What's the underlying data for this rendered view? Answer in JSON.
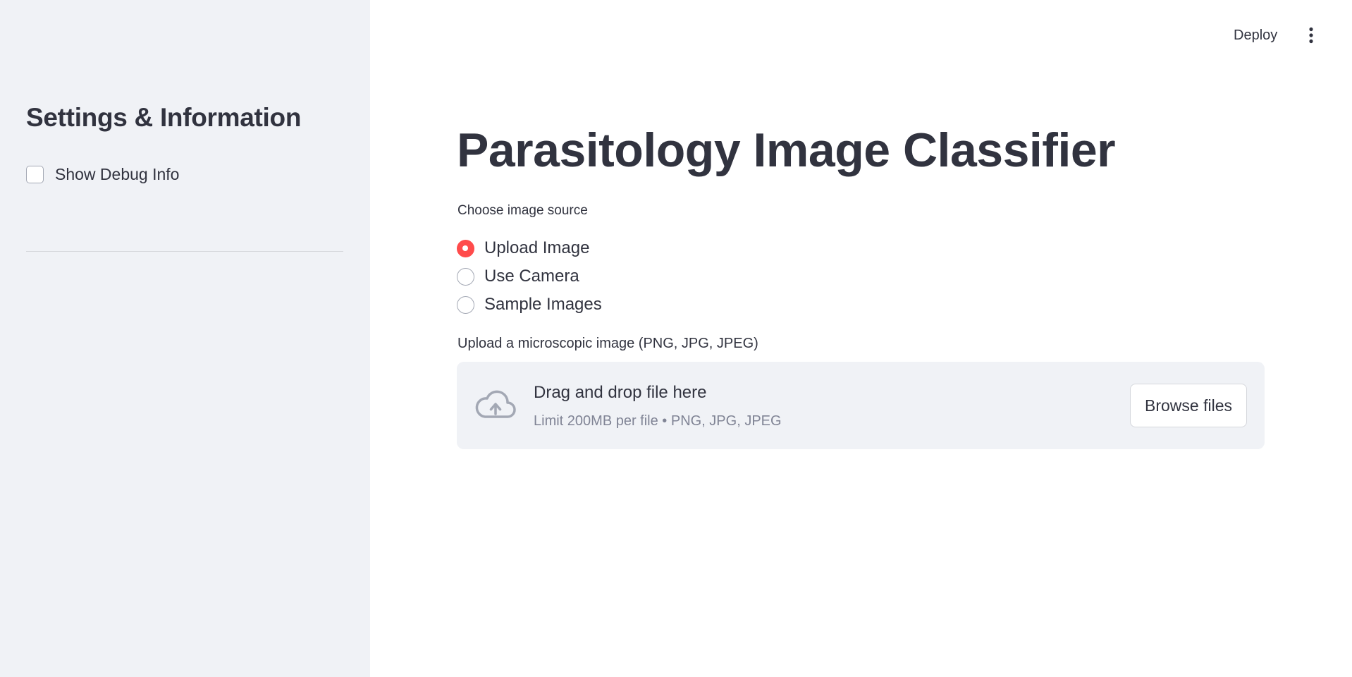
{
  "sidebar": {
    "title": "Settings & Information",
    "debug_checkbox": {
      "label": "Show Debug Info",
      "checked": false
    }
  },
  "header": {
    "deploy_label": "Deploy",
    "menu_icon": "vertical-ellipsis-icon"
  },
  "main": {
    "title": "Parasitology Image Classifier",
    "image_source": {
      "caption": "Choose image source",
      "options": [
        {
          "label": "Upload Image",
          "selected": true
        },
        {
          "label": "Use Camera",
          "selected": false
        },
        {
          "label": "Sample Images",
          "selected": false
        }
      ]
    },
    "uploader": {
      "caption": "Upload a microscopic image (PNG, JPG, JPEG)",
      "icon": "cloud-upload-icon",
      "title": "Drag and drop file here",
      "subtitle": "Limit 200MB per file • PNG, JPG, JPEG",
      "browse_label": "Browse files"
    }
  },
  "colors": {
    "accent": "#ff4b4b",
    "sidebar_bg": "#f0f2f6",
    "text": "#31333f",
    "muted_text": "#808495"
  }
}
